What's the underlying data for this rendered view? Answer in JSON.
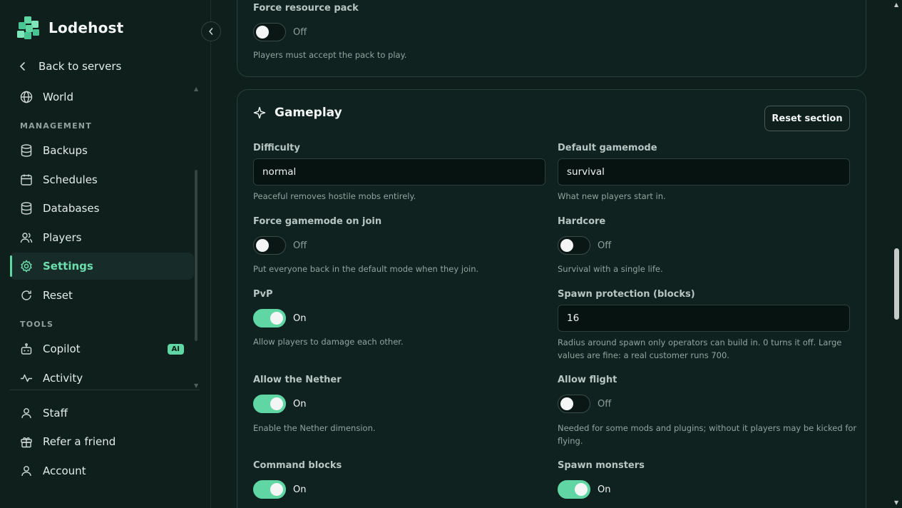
{
  "brand": {
    "name": "Lodehost"
  },
  "sidebar": {
    "back": "Back to servers",
    "world": "World",
    "management_label": "MANAGEMENT",
    "management": [
      "Backups",
      "Schedules",
      "Databases",
      "Players",
      "Settings",
      "Reset"
    ],
    "tools_label": "TOOLS",
    "tools": [
      "Copilot",
      "Activity"
    ],
    "copilot_badge": "AI",
    "footer": [
      "Staff",
      "Refer a friend",
      "Account"
    ],
    "active": "Settings"
  },
  "top_card": {
    "force_resource_pack": {
      "label": "Force resource pack",
      "state": "Off",
      "help": "Players must accept the pack to play."
    }
  },
  "gameplay": {
    "title": "Gameplay",
    "reset_label": "Reset section",
    "difficulty": {
      "label": "Difficulty",
      "value": "normal",
      "help": "Peaceful removes hostile mobs entirely."
    },
    "default_gamemode": {
      "label": "Default gamemode",
      "value": "survival",
      "help": "What new players start in."
    },
    "force_gamemode": {
      "label": "Force gamemode on join",
      "state": "Off",
      "help": "Put everyone back in the default mode when they join."
    },
    "hardcore": {
      "label": "Hardcore",
      "state": "Off",
      "help": "Survival with a single life."
    },
    "pvp": {
      "label": "PvP",
      "state": "On",
      "help": "Allow players to damage each other."
    },
    "spawn_protection": {
      "label": "Spawn protection (blocks)",
      "value": "16",
      "help1": "Radius around spawn only operators can build in. 0 turns it off. Large",
      "help2": "values are fine: a real customer runs 700."
    },
    "allow_nether": {
      "label": "Allow the Nether",
      "state": "On",
      "help": "Enable the Nether dimension."
    },
    "allow_flight": {
      "label": "Allow flight",
      "state": "Off",
      "help1": "Needed for some mods and plugins; without it players may be kicked for",
      "help2": "flying."
    },
    "command_blocks": {
      "label": "Command blocks",
      "state": "On"
    },
    "spawn_monsters": {
      "label": "Spawn monsters",
      "state": "On"
    }
  },
  "colors": {
    "accent": "#5fd6a3",
    "background": "#0f1f1c",
    "card": "#10221f"
  }
}
